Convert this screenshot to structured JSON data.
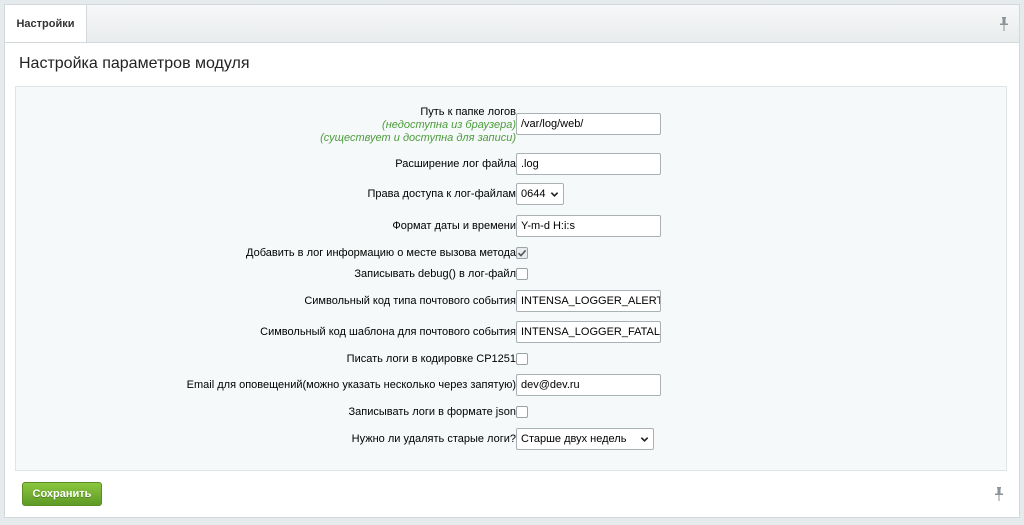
{
  "tabs": [
    {
      "label": "Настройки"
    }
  ],
  "panel": {
    "title": "Настройка параметров модуля"
  },
  "fields": {
    "log_path": {
      "label": "Путь к папке логов",
      "note1": "(недоступна из браузера)",
      "note2": "(существует и доступна для записи)",
      "value": "/var/log/web/"
    },
    "log_ext": {
      "label": "Расширение лог файла",
      "value": ".log"
    },
    "perms": {
      "label": "Права доступа к лог-файлам",
      "value": "0644"
    },
    "date_format": {
      "label": "Формат даты и времени",
      "value": "Y-m-d H:i:s"
    },
    "call_info": {
      "label": "Добавить в лог информацию о месте вызова метода",
      "checked": true
    },
    "debug": {
      "label": "Записывать debug() в лог-файл",
      "checked": false
    },
    "event_type": {
      "label": "Символьный код типа почтового события",
      "value": "INTENSA_LOGGER_ALERT"
    },
    "template": {
      "label": "Символьный код шаблона для почтового события",
      "value": "INTENSA_LOGGER_FATAL_"
    },
    "cp1251": {
      "label": "Писать логи в кодировке CP1251",
      "checked": false
    },
    "email": {
      "label": "Email для оповещений(можно указать несколько через запятую)",
      "value": "dev@dev.ru"
    },
    "json": {
      "label": "Записывать логи в формате json",
      "checked": false
    },
    "delete_old": {
      "label": "Нужно ли удалять старые логи?",
      "value": "Старше двух недель"
    }
  },
  "footer": {
    "save_label": "Сохранить"
  },
  "icons": {
    "pin": "pin-icon",
    "check": "check-icon",
    "dropdown": "chevron-down-icon"
  }
}
